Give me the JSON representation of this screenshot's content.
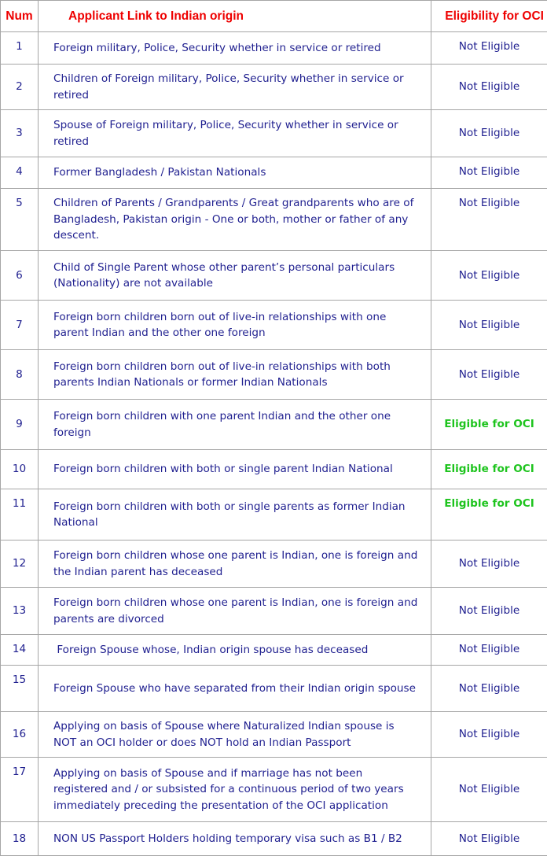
{
  "table": {
    "headers": {
      "num": "Num",
      "link": "Applicant Link to Indian origin",
      "eligibility": "Eligibility for OCI"
    },
    "colors": {
      "header_text": "#ee0000",
      "body_text": "#1f1f8f",
      "eligible_text": "#1ec41e",
      "border": "#a6a6a6"
    },
    "rows": [
      {
        "num": "1",
        "link": "Foreign military, Police, Security whether in service or retired",
        "eligibility": "Not Eligible",
        "eligible": false
      },
      {
        "num": "2",
        "link": "Children of Foreign military, Police, Security whether in service or retired",
        "eligibility": "Not Eligible",
        "eligible": false
      },
      {
        "num": "3",
        "link": "Spouse of Foreign military, Police, Security whether in service or retired",
        "eligibility": "Not Eligible",
        "eligible": false
      },
      {
        "num": "4",
        "link": "Former Bangladesh / Pakistan Nationals",
        "eligibility": "Not Eligible",
        "eligible": false
      },
      {
        "num": "5",
        "link": "Children of Parents / Grandparents / Great grandparents who are of Bangladesh, Pakistan origin - One or both, mother or father of any descent.",
        "eligibility": "Not Eligible",
        "eligible": false
      },
      {
        "num": "6",
        "link": "Child of Single Parent whose other parent’s personal particulars (Nationality) are not available",
        "eligibility": "Not Eligible",
        "eligible": false
      },
      {
        "num": "7",
        "link": "Foreign born children born out of live-in relationships with one parent Indian and the other one foreign",
        "eligibility": "Not Eligible",
        "eligible": false
      },
      {
        "num": "8",
        "link": "Foreign born children born out of live-in relationships with both parents Indian Nationals or former Indian Nationals",
        "eligibility": "Not Eligible",
        "eligible": false
      },
      {
        "num": "9",
        "link": "Foreign born children with one parent Indian and the other one foreign",
        "eligibility": "Eligible for OCI",
        "eligible": true
      },
      {
        "num": "10",
        "link": "Foreign born children with both or single parent Indian National",
        "eligibility": "Eligible for OCI",
        "eligible": true
      },
      {
        "num": "11",
        "link": "Foreign born children with both or single parents as former Indian National",
        "eligibility": "Eligible for OCI",
        "eligible": true
      },
      {
        "num": "12",
        "link": "Foreign born children whose one parent is Indian, one is foreign and the Indian parent has deceased",
        "eligibility": "Not Eligible",
        "eligible": false
      },
      {
        "num": "13",
        "link": "Foreign born children whose one parent is Indian, one is foreign and parents are divorced",
        "eligibility": "Not Eligible",
        "eligible": false
      },
      {
        "num": "14",
        "link": " Foreign Spouse whose, Indian origin spouse has deceased",
        "eligibility": "Not Eligible",
        "eligible": false
      },
      {
        "num": "15",
        "link": "Foreign Spouse who have separated from their Indian origin spouse",
        "eligibility": "Not Eligible",
        "eligible": false
      },
      {
        "num": "16",
        "link": "Applying on basis of Spouse where Naturalized Indian spouse is NOT an OCI holder or does NOT hold an Indian Passport",
        "eligibility": "Not Eligible",
        "eligible": false
      },
      {
        "num": "17",
        "link": "Applying on basis of Spouse and if marriage has not been registered and / or subsisted for a continuous period of two years immediately preceding the presentation of the OCI application",
        "eligibility": "Not Eligible",
        "eligible": false
      },
      {
        "num": "18",
        "link": "NON US Passport Holders holding temporary visa such as B1 / B2",
        "eligibility": "Not Eligible",
        "eligible": false
      }
    ]
  }
}
